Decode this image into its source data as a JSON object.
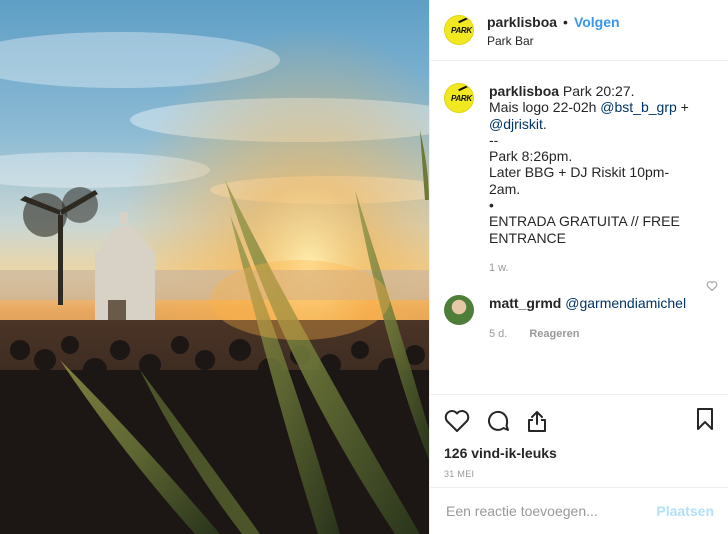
{
  "post": {
    "username": "parklisboa",
    "follow_label": "Volgen",
    "location": "Park Bar"
  },
  "caption": {
    "username": "parklisboa",
    "line1": "Park 20:27.",
    "line2_pre": "Mais logo 22-02h ",
    "mention1": "@bst_b_grp",
    "plus": " + ",
    "mention2": "@djriskit",
    "period": ".",
    "line3": "--",
    "line4": "Park 8:26pm.",
    "line5": "Later BBG + DJ Riskit 10pm-2am.",
    "line6": "•",
    "line7": "ENTRADA GRATUITA // FREE ENTRANCE",
    "time": "1 w."
  },
  "reply": {
    "username": "matt_grmd",
    "mention": "@garmendiamichel",
    "time": "5 d.",
    "reply_label": "Reageren"
  },
  "likes": "126 vind-ik-leuks",
  "date": "31 MEI",
  "add_comment": {
    "placeholder": "Een reactie toevoegen...",
    "post_label": "Plaatsen"
  },
  "icons": [
    "heart-icon",
    "comment-icon",
    "share-icon",
    "bookmark-icon"
  ],
  "colors": {
    "link": "#3897f0",
    "mention": "#003569",
    "muted": "#999999",
    "post_disabled": "#b2dffc"
  }
}
